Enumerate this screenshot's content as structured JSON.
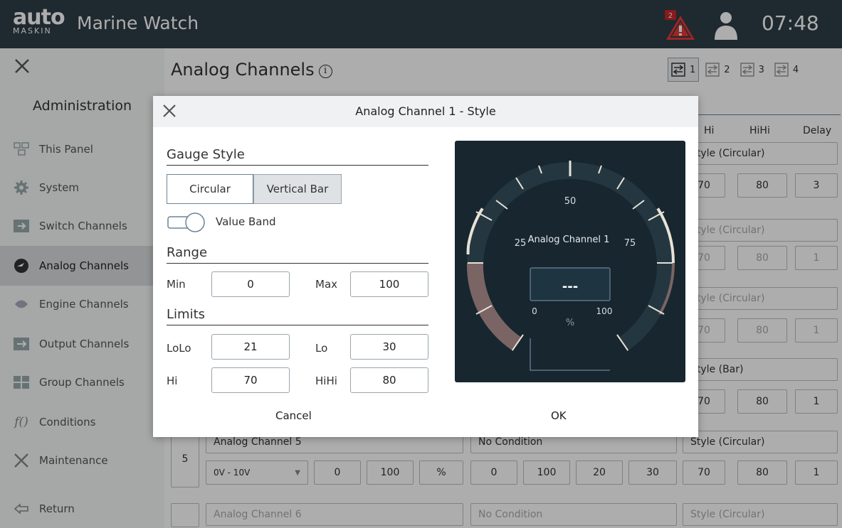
{
  "app": {
    "logo_top": "auto",
    "logo_bottom": "MASKIN",
    "title": "Marine Watch",
    "clock": "07:48",
    "alarm_count": "2"
  },
  "sidebar": {
    "header": "Administration",
    "items": [
      {
        "label": "This Panel",
        "icon": "panel-icon"
      },
      {
        "label": "System",
        "icon": "gear-icon"
      },
      {
        "label": "Switch Channels",
        "icon": "switch-icon"
      },
      {
        "label": "Analog Channels",
        "icon": "analog-icon",
        "active": true
      },
      {
        "label": "Engine Channels",
        "icon": "engine-icon"
      },
      {
        "label": "Output Channels",
        "icon": "output-icon"
      },
      {
        "label": "Group Channels",
        "icon": "group-icon"
      },
      {
        "label": "Conditions",
        "icon": "function-icon"
      },
      {
        "label": "Maintenance",
        "icon": "tools-icon"
      },
      {
        "label": "Return",
        "icon": "return-icon"
      }
    ]
  },
  "main": {
    "title": "Analog Channels",
    "pages": [
      "1",
      "2",
      "3",
      "4"
    ],
    "columns": {
      "hi": "Hi",
      "hihi": "HiHi",
      "delay": "Delay"
    },
    "right_column": [
      {
        "style": "Style (Circular)",
        "hi": "70",
        "hihi": "80",
        "delay": "3"
      },
      {
        "style": "Style (Circular)",
        "hi": "70",
        "hihi": "80",
        "delay": "1"
      },
      {
        "style": "Style (Circular)",
        "hi": "70",
        "hihi": "80",
        "delay": "1"
      },
      {
        "style": "Style (Bar)",
        "hi": "70",
        "hihi": "80",
        "delay": "1"
      }
    ],
    "row5": {
      "num": "5",
      "name": "Analog Channel 5",
      "condition": "No Condition",
      "style": "Style (Circular)",
      "signal": "0V - 10V",
      "min": "0",
      "max": "100",
      "unit": "%",
      "lolo_min": "0",
      "lolo_max": "100",
      "lo1": "20",
      "lo2": "30",
      "hi": "70",
      "hihi": "80",
      "delay": "1"
    },
    "row6": {
      "name": "Analog Channel 6",
      "condition": "No Condition",
      "style": "Style (Circular)"
    }
  },
  "modal": {
    "title": "Analog Channel 1 - Style",
    "gauge_style_heading": "Gauge Style",
    "circular": "Circular",
    "vertical_bar": "Vertical Bar",
    "value_band": "Value Band",
    "range_heading": "Range",
    "min_label": "Min",
    "min": "0",
    "max_label": "Max",
    "max": "100",
    "limits_heading": "Limits",
    "lolo_label": "LoLo",
    "lolo": "21",
    "lo_label": "Lo",
    "lo": "30",
    "hi_label": "Hi",
    "hi": "70",
    "hihi_label": "HiHi",
    "hihi": "80",
    "cancel": "Cancel",
    "ok": "OK",
    "gauge": {
      "name": "Analog Channel 1",
      "value": "---",
      "unit": "%",
      "ticks": {
        "t0": "0",
        "t25": "25",
        "t50": "50",
        "t75": "75",
        "t100": "100"
      }
    }
  }
}
